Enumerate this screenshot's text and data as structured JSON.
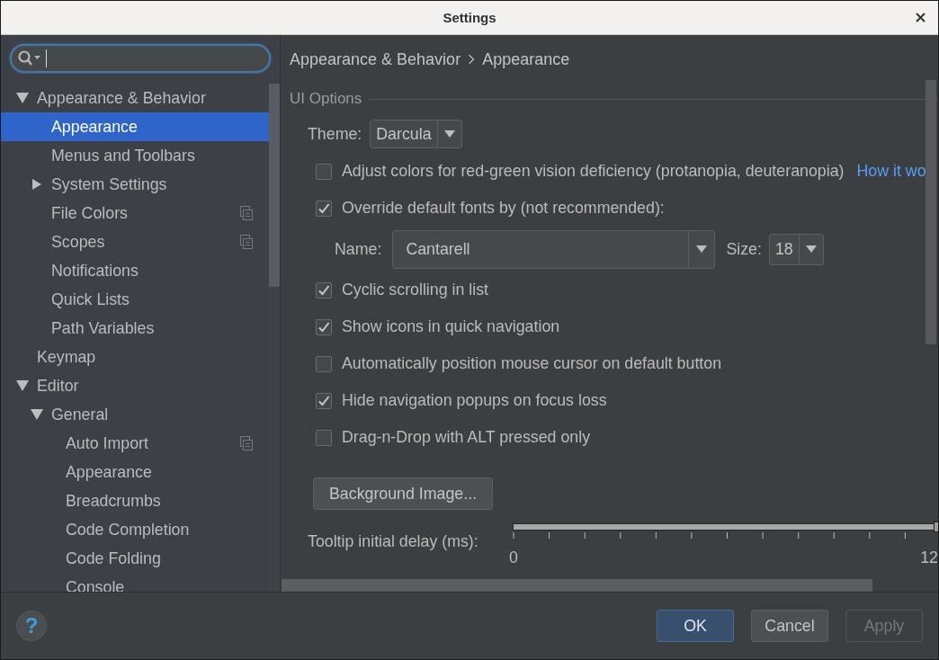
{
  "window": {
    "title": "Settings"
  },
  "sidebar": {
    "items": [
      {
        "label": "Appearance & Behavior",
        "expanded": true,
        "selected": false,
        "project_icon": false,
        "children": [
          {
            "label": "Appearance",
            "selected": true,
            "project_icon": false
          },
          {
            "label": "Menus and Toolbars",
            "selected": false,
            "project_icon": false
          },
          {
            "label": "System Settings",
            "expanded": false,
            "selected": false,
            "project_icon": false
          },
          {
            "label": "File Colors",
            "selected": false,
            "project_icon": true
          },
          {
            "label": "Scopes",
            "selected": false,
            "project_icon": true
          },
          {
            "label": "Notifications",
            "selected": false,
            "project_icon": false
          },
          {
            "label": "Quick Lists",
            "selected": false,
            "project_icon": false
          },
          {
            "label": "Path Variables",
            "selected": false,
            "project_icon": false
          }
        ]
      },
      {
        "label": "Keymap",
        "selected": false,
        "project_icon": false
      },
      {
        "label": "Editor",
        "expanded": true,
        "selected": false,
        "project_icon": false,
        "children": [
          {
            "label": "General",
            "expanded": true,
            "selected": false,
            "project_icon": false,
            "children": [
              {
                "label": "Auto Import",
                "selected": false,
                "project_icon": true
              },
              {
                "label": "Appearance",
                "selected": false,
                "project_icon": false
              },
              {
                "label": "Breadcrumbs",
                "selected": false,
                "project_icon": false
              },
              {
                "label": "Code Completion",
                "selected": false,
                "project_icon": false
              },
              {
                "label": "Code Folding",
                "selected": false,
                "project_icon": false
              },
              {
                "label": "Console",
                "selected": false,
                "project_icon": false
              }
            ]
          }
        ]
      }
    ]
  },
  "breadcrumb": [
    "Appearance & Behavior",
    "Appearance"
  ],
  "section": {
    "title": "UI Options"
  },
  "options": [
    {
      "kind": "dropdown",
      "label": "Theme:",
      "value": "Darcula"
    },
    {
      "kind": "checkbox",
      "label": "Adjust colors for red-green vision deficiency (protanopia, deuteranopia)",
      "checked": false,
      "link": "How it wo"
    },
    {
      "kind": "checkbox",
      "label": "Override default fonts by (not recommended):",
      "checked": true
    },
    {
      "kind": "font",
      "name_label": "Name:",
      "name_value": "Cantarell",
      "size_label": "Size:",
      "size_value": "18"
    },
    {
      "kind": "checkbox",
      "label": "Cyclic scrolling in list",
      "checked": true
    },
    {
      "kind": "checkbox",
      "label": "Show icons in quick navigation",
      "checked": true
    },
    {
      "kind": "checkbox",
      "label": "Automatically position mouse cursor on default button",
      "checked": false
    },
    {
      "kind": "checkbox",
      "label": "Hide navigation popups on focus loss",
      "checked": true
    },
    {
      "kind": "checkbox",
      "label": "Drag-n-Drop with ALT pressed only",
      "checked": false
    },
    {
      "kind": "button",
      "label": "Background Image..."
    },
    {
      "kind": "slider",
      "label": "Tooltip initial delay (ms):",
      "level": 1,
      "min_label": "0",
      "max_label": "12"
    }
  ],
  "help": {
    "label": "?"
  },
  "buttons": [
    {
      "label": "OK",
      "kind": "default",
      "disabled": false
    },
    {
      "label": "Cancel",
      "kind": "normal",
      "disabled": false
    },
    {
      "label": "Apply",
      "kind": "normal",
      "disabled": true
    }
  ]
}
